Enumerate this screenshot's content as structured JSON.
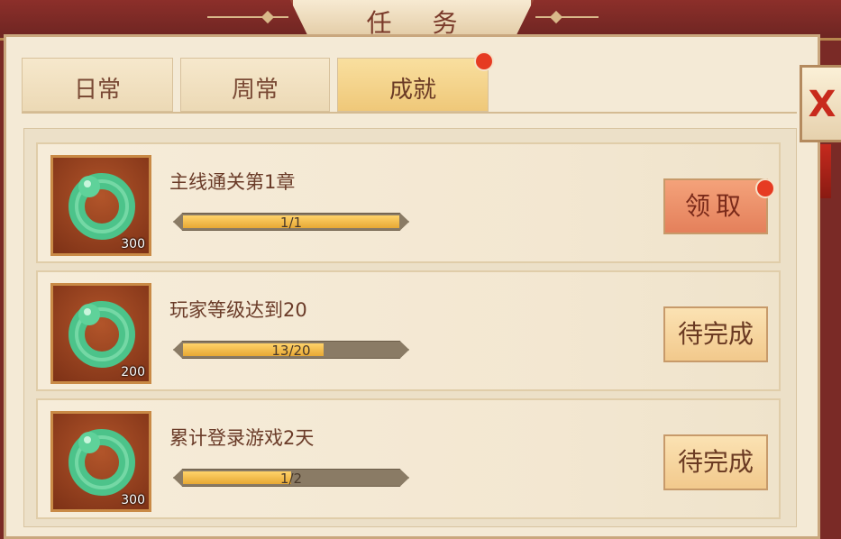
{
  "window": {
    "title": "任 务"
  },
  "tabs": [
    {
      "label": "日常",
      "active": false
    },
    {
      "label": "周常",
      "active": false
    },
    {
      "label": "成就",
      "active": true,
      "notification": true
    }
  ],
  "tasks": [
    {
      "name": "主线通关第1章",
      "progress_text": "1/1",
      "progress": 1.0,
      "reward_count": "300",
      "button_label": "领取",
      "button_state": "claim",
      "notification": true
    },
    {
      "name": "玩家等级达到20",
      "progress_text": "13/20",
      "progress": 0.65,
      "reward_count": "200",
      "button_label": "待完成",
      "button_state": "pending"
    },
    {
      "name": "累计登录游戏2天",
      "progress_text": "1/2",
      "progress": 0.5,
      "reward_count": "300",
      "button_label": "待完成",
      "button_state": "pending"
    }
  ],
  "close": {
    "label": "X"
  },
  "colors": {
    "accent": "#e63b22",
    "progress_fill": "#f0b745",
    "panel_bg": "#f4ead6",
    "frame": "#7a2a26"
  },
  "icons": {
    "reward": "jade-ring-icon"
  }
}
